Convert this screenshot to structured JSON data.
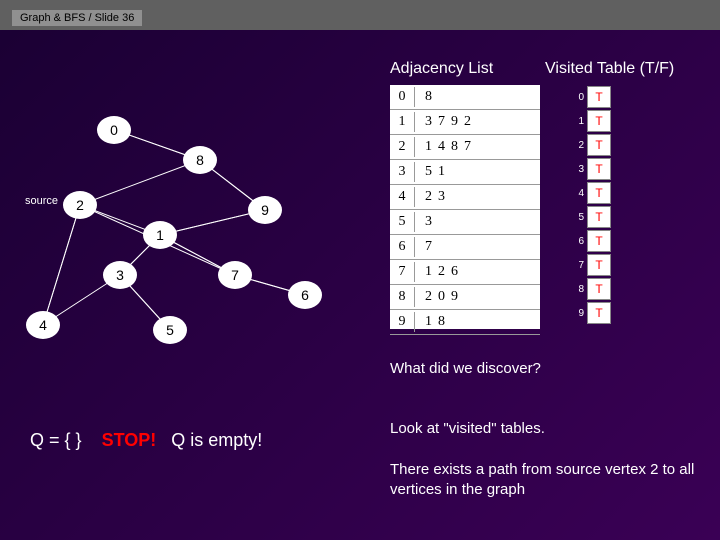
{
  "header": "Graph & BFS / Slide 36",
  "titles": {
    "adjacency": "Adjacency List",
    "visited": "Visited Table (T/F)"
  },
  "adjacency": [
    {
      "idx": "0",
      "vals": "8"
    },
    {
      "idx": "1",
      "vals": "3792"
    },
    {
      "idx": "2",
      "vals": "1487"
    },
    {
      "idx": "3",
      "vals": "51"
    },
    {
      "idx": "4",
      "vals": "23"
    },
    {
      "idx": "5",
      "vals": "3"
    },
    {
      "idx": "6",
      "vals": "7"
    },
    {
      "idx": "7",
      "vals": "126"
    },
    {
      "idx": "8",
      "vals": "209"
    },
    {
      "idx": "9",
      "vals": "18"
    }
  ],
  "visited": [
    {
      "idx": "0",
      "val": "T"
    },
    {
      "idx": "1",
      "val": "T"
    },
    {
      "idx": "2",
      "val": "T"
    },
    {
      "idx": "3",
      "val": "T"
    },
    {
      "idx": "4",
      "val": "T"
    },
    {
      "idx": "5",
      "val": "T"
    },
    {
      "idx": "6",
      "val": "T"
    },
    {
      "idx": "7",
      "val": "T"
    },
    {
      "idx": "8",
      "val": "T"
    },
    {
      "idx": "9",
      "val": "T"
    }
  ],
  "graph": {
    "source_label": "source",
    "nodes": {
      "n0": "0",
      "n1": "1",
      "n2": "2",
      "n3": "3",
      "n4": "4",
      "n5": "5",
      "n6": "6",
      "n7": "7",
      "n8": "8",
      "n9": "9"
    }
  },
  "text": {
    "discover": "What did we discover?",
    "look": "Look at \"visited\" tables.",
    "exists": "There exists a path from source vertex 2 to all vertices in the graph"
  },
  "queue": {
    "prefix": "Q =",
    "braces": "{  }",
    "stop": "STOP!",
    "msg": "Q is empty!"
  }
}
